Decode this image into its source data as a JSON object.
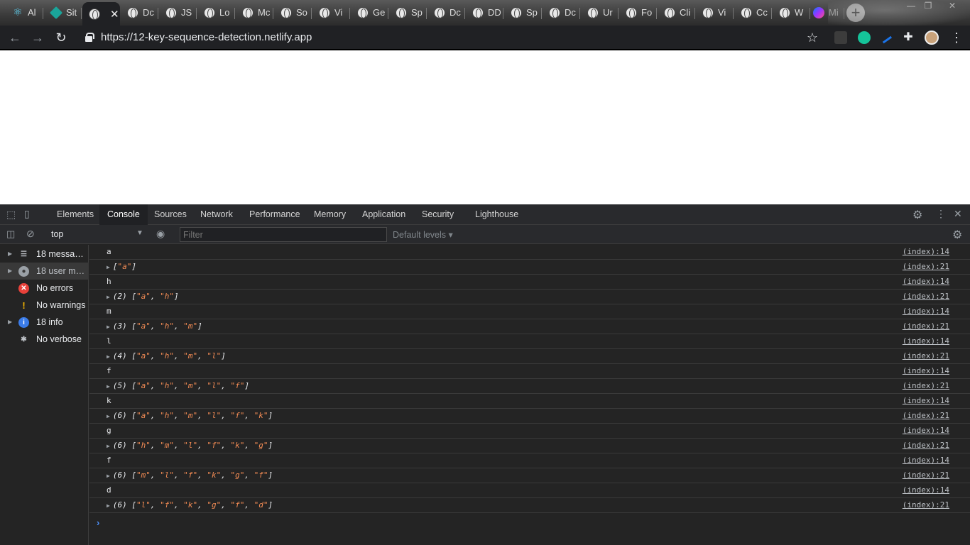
{
  "browser": {
    "tabs": [
      {
        "label": "Al",
        "icon": "react-icon"
      },
      {
        "label": "Sit",
        "icon": "diamond-icon"
      },
      {
        "label": "",
        "icon": "globe-icon",
        "active": true
      },
      {
        "label": "Dc",
        "icon": "globe-icon"
      },
      {
        "label": "JS",
        "icon": "globe-icon"
      },
      {
        "label": "Lo",
        "icon": "globe-icon"
      },
      {
        "label": "Mc",
        "icon": "globe-icon"
      },
      {
        "label": "So",
        "icon": "globe-icon"
      },
      {
        "label": "Vi",
        "icon": "globe-icon"
      },
      {
        "label": "Ge",
        "icon": "globe-icon"
      },
      {
        "label": "Sp",
        "icon": "globe-icon"
      },
      {
        "label": "Dc",
        "icon": "globe-icon"
      },
      {
        "label": "DD",
        "icon": "globe-icon"
      },
      {
        "label": "Sp",
        "icon": "globe-icon"
      },
      {
        "label": "Dc",
        "icon": "globe-icon"
      },
      {
        "label": "Ur",
        "icon": "globe-icon"
      },
      {
        "label": "Fo",
        "icon": "globe-icon"
      },
      {
        "label": "Cli",
        "icon": "globe-icon"
      },
      {
        "label": "Vi",
        "icon": "globe-icon"
      },
      {
        "label": "Cc",
        "icon": "globe-icon"
      },
      {
        "label": "W",
        "icon": "globe-icon"
      },
      {
        "label": "Mi",
        "icon": "messenger-icon"
      }
    ],
    "close_glyph": "✕",
    "new_tab_glyph": "+",
    "window_controls": {
      "minimize": "—",
      "restore": "❐",
      "close": "✕"
    },
    "url": "https://12-key-sequence-detection.netlify.app"
  },
  "devtools": {
    "tabs": [
      "Elements",
      "Console",
      "Sources",
      "Network",
      "Performance",
      "Memory",
      "Application",
      "Security",
      "Lighthouse"
    ],
    "active_tab": "Console",
    "context": "top",
    "filter_placeholder": "Filter",
    "levels": "Default levels",
    "sidebar": [
      {
        "label": "18 messages",
        "icon": "list-icon",
        "expandable": true
      },
      {
        "label": "18 user messages",
        "icon": "user-icon",
        "expandable": true,
        "selected": true
      },
      {
        "label": "No errors",
        "icon": "error-icon",
        "expandable": false
      },
      {
        "label": "No warnings",
        "icon": "warning-icon",
        "expandable": false
      },
      {
        "label": "18 info",
        "icon": "info-icon",
        "expandable": true
      },
      {
        "label": "No verbose",
        "icon": "bug-icon",
        "expandable": false
      }
    ],
    "logs": [
      {
        "kind": "text",
        "text": "a",
        "source": "(index):14"
      },
      {
        "kind": "array",
        "prefix": "",
        "items": [
          "a"
        ],
        "source": "(index):21"
      },
      {
        "kind": "text",
        "text": "h",
        "source": "(index):14"
      },
      {
        "kind": "array",
        "prefix": "(2) ",
        "items": [
          "a",
          "h"
        ],
        "source": "(index):21"
      },
      {
        "kind": "text",
        "text": "m",
        "source": "(index):14"
      },
      {
        "kind": "array",
        "prefix": "(3) ",
        "items": [
          "a",
          "h",
          "m"
        ],
        "source": "(index):21"
      },
      {
        "kind": "text",
        "text": "l",
        "source": "(index):14"
      },
      {
        "kind": "array",
        "prefix": "(4) ",
        "items": [
          "a",
          "h",
          "m",
          "l"
        ],
        "source": "(index):21"
      },
      {
        "kind": "text",
        "text": "f",
        "source": "(index):14"
      },
      {
        "kind": "array",
        "prefix": "(5) ",
        "items": [
          "a",
          "h",
          "m",
          "l",
          "f"
        ],
        "source": "(index):21"
      },
      {
        "kind": "text",
        "text": "k",
        "source": "(index):14"
      },
      {
        "kind": "array",
        "prefix": "(6) ",
        "items": [
          "a",
          "h",
          "m",
          "l",
          "f",
          "k"
        ],
        "source": "(index):21"
      },
      {
        "kind": "text",
        "text": "g",
        "source": "(index):14"
      },
      {
        "kind": "array",
        "prefix": "(6) ",
        "items": [
          "h",
          "m",
          "l",
          "f",
          "k",
          "g"
        ],
        "source": "(index):21"
      },
      {
        "kind": "text",
        "text": "f",
        "source": "(index):14"
      },
      {
        "kind": "array",
        "prefix": "(6) ",
        "items": [
          "m",
          "l",
          "f",
          "k",
          "g",
          "f"
        ],
        "source": "(index):21"
      },
      {
        "kind": "text",
        "text": "d",
        "source": "(index):14"
      },
      {
        "kind": "array",
        "prefix": "(6) ",
        "items": [
          "l",
          "f",
          "k",
          "g",
          "f",
          "d"
        ],
        "source": "(index):21"
      }
    ],
    "prompt_glyph": "›"
  }
}
